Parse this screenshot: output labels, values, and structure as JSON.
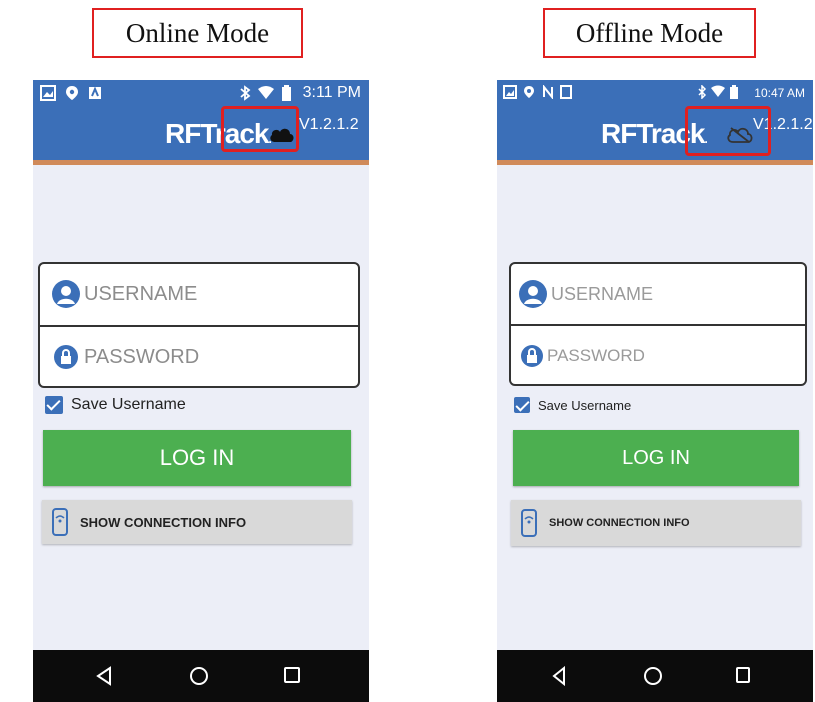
{
  "labels": {
    "online": "Online Mode",
    "offline": "Offline Mode"
  },
  "colors": {
    "appbar": "#3b6fb8",
    "accent_border": "#d08a5a",
    "login_button": "#4caf50",
    "highlight": "#e02020",
    "navbar": "#0c0c0c"
  },
  "online": {
    "status_time": "3:11 PM",
    "brand": "RFTrack",
    "version": "V1.2.1.2",
    "cloud_icon": "cloud-filled-icon",
    "username_placeholder": "USERNAME",
    "password_placeholder": "PASSWORD",
    "save_username_label": "Save Username",
    "save_username_checked": true,
    "login_label": "LOG IN",
    "connection_info_label": "SHOW CONNECTION INFO"
  },
  "offline": {
    "status_time": "10:47 AM",
    "brand": "RFTrack",
    "version": "V1.2.1.2",
    "cloud_icon": "cloud-off-icon",
    "username_placeholder": "USERNAME",
    "password_placeholder": "PASSWORD",
    "save_username_label": "Save Username",
    "save_username_checked": true,
    "login_label": "LOG IN",
    "connection_info_label": "SHOW CONNECTION INFO"
  }
}
